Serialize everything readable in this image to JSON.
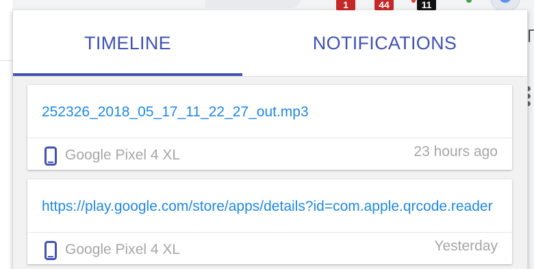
{
  "toolbar": {
    "badges": [
      {
        "name": "extension-badge-1",
        "value": "1",
        "color": "#c62828"
      },
      {
        "name": "extension-badge-2",
        "value": "44",
        "color": "#c62828"
      },
      {
        "name": "extension-badge-3",
        "value": "11",
        "color": "#111111"
      }
    ],
    "side_glyph": "∏"
  },
  "popup": {
    "tabs": [
      {
        "label": "TIMELINE",
        "active": true
      },
      {
        "label": "NOTIFICATIONS",
        "active": false
      }
    ],
    "accent_color": "#3f51b5",
    "link_color": "#1e88e5",
    "items": [
      {
        "title": "252326_2018_05_17_11_22_27_out.mp3",
        "device": "Google Pixel 4 XL",
        "device_icon": "smartphone-icon",
        "time": "23 hours ago"
      },
      {
        "title": "https://play.google.com/store/apps/details?id=com.apple.qrcode.reader",
        "device": "Google Pixel 4 XL",
        "device_icon": "smartphone-icon",
        "time": "Yesterday"
      }
    ]
  }
}
